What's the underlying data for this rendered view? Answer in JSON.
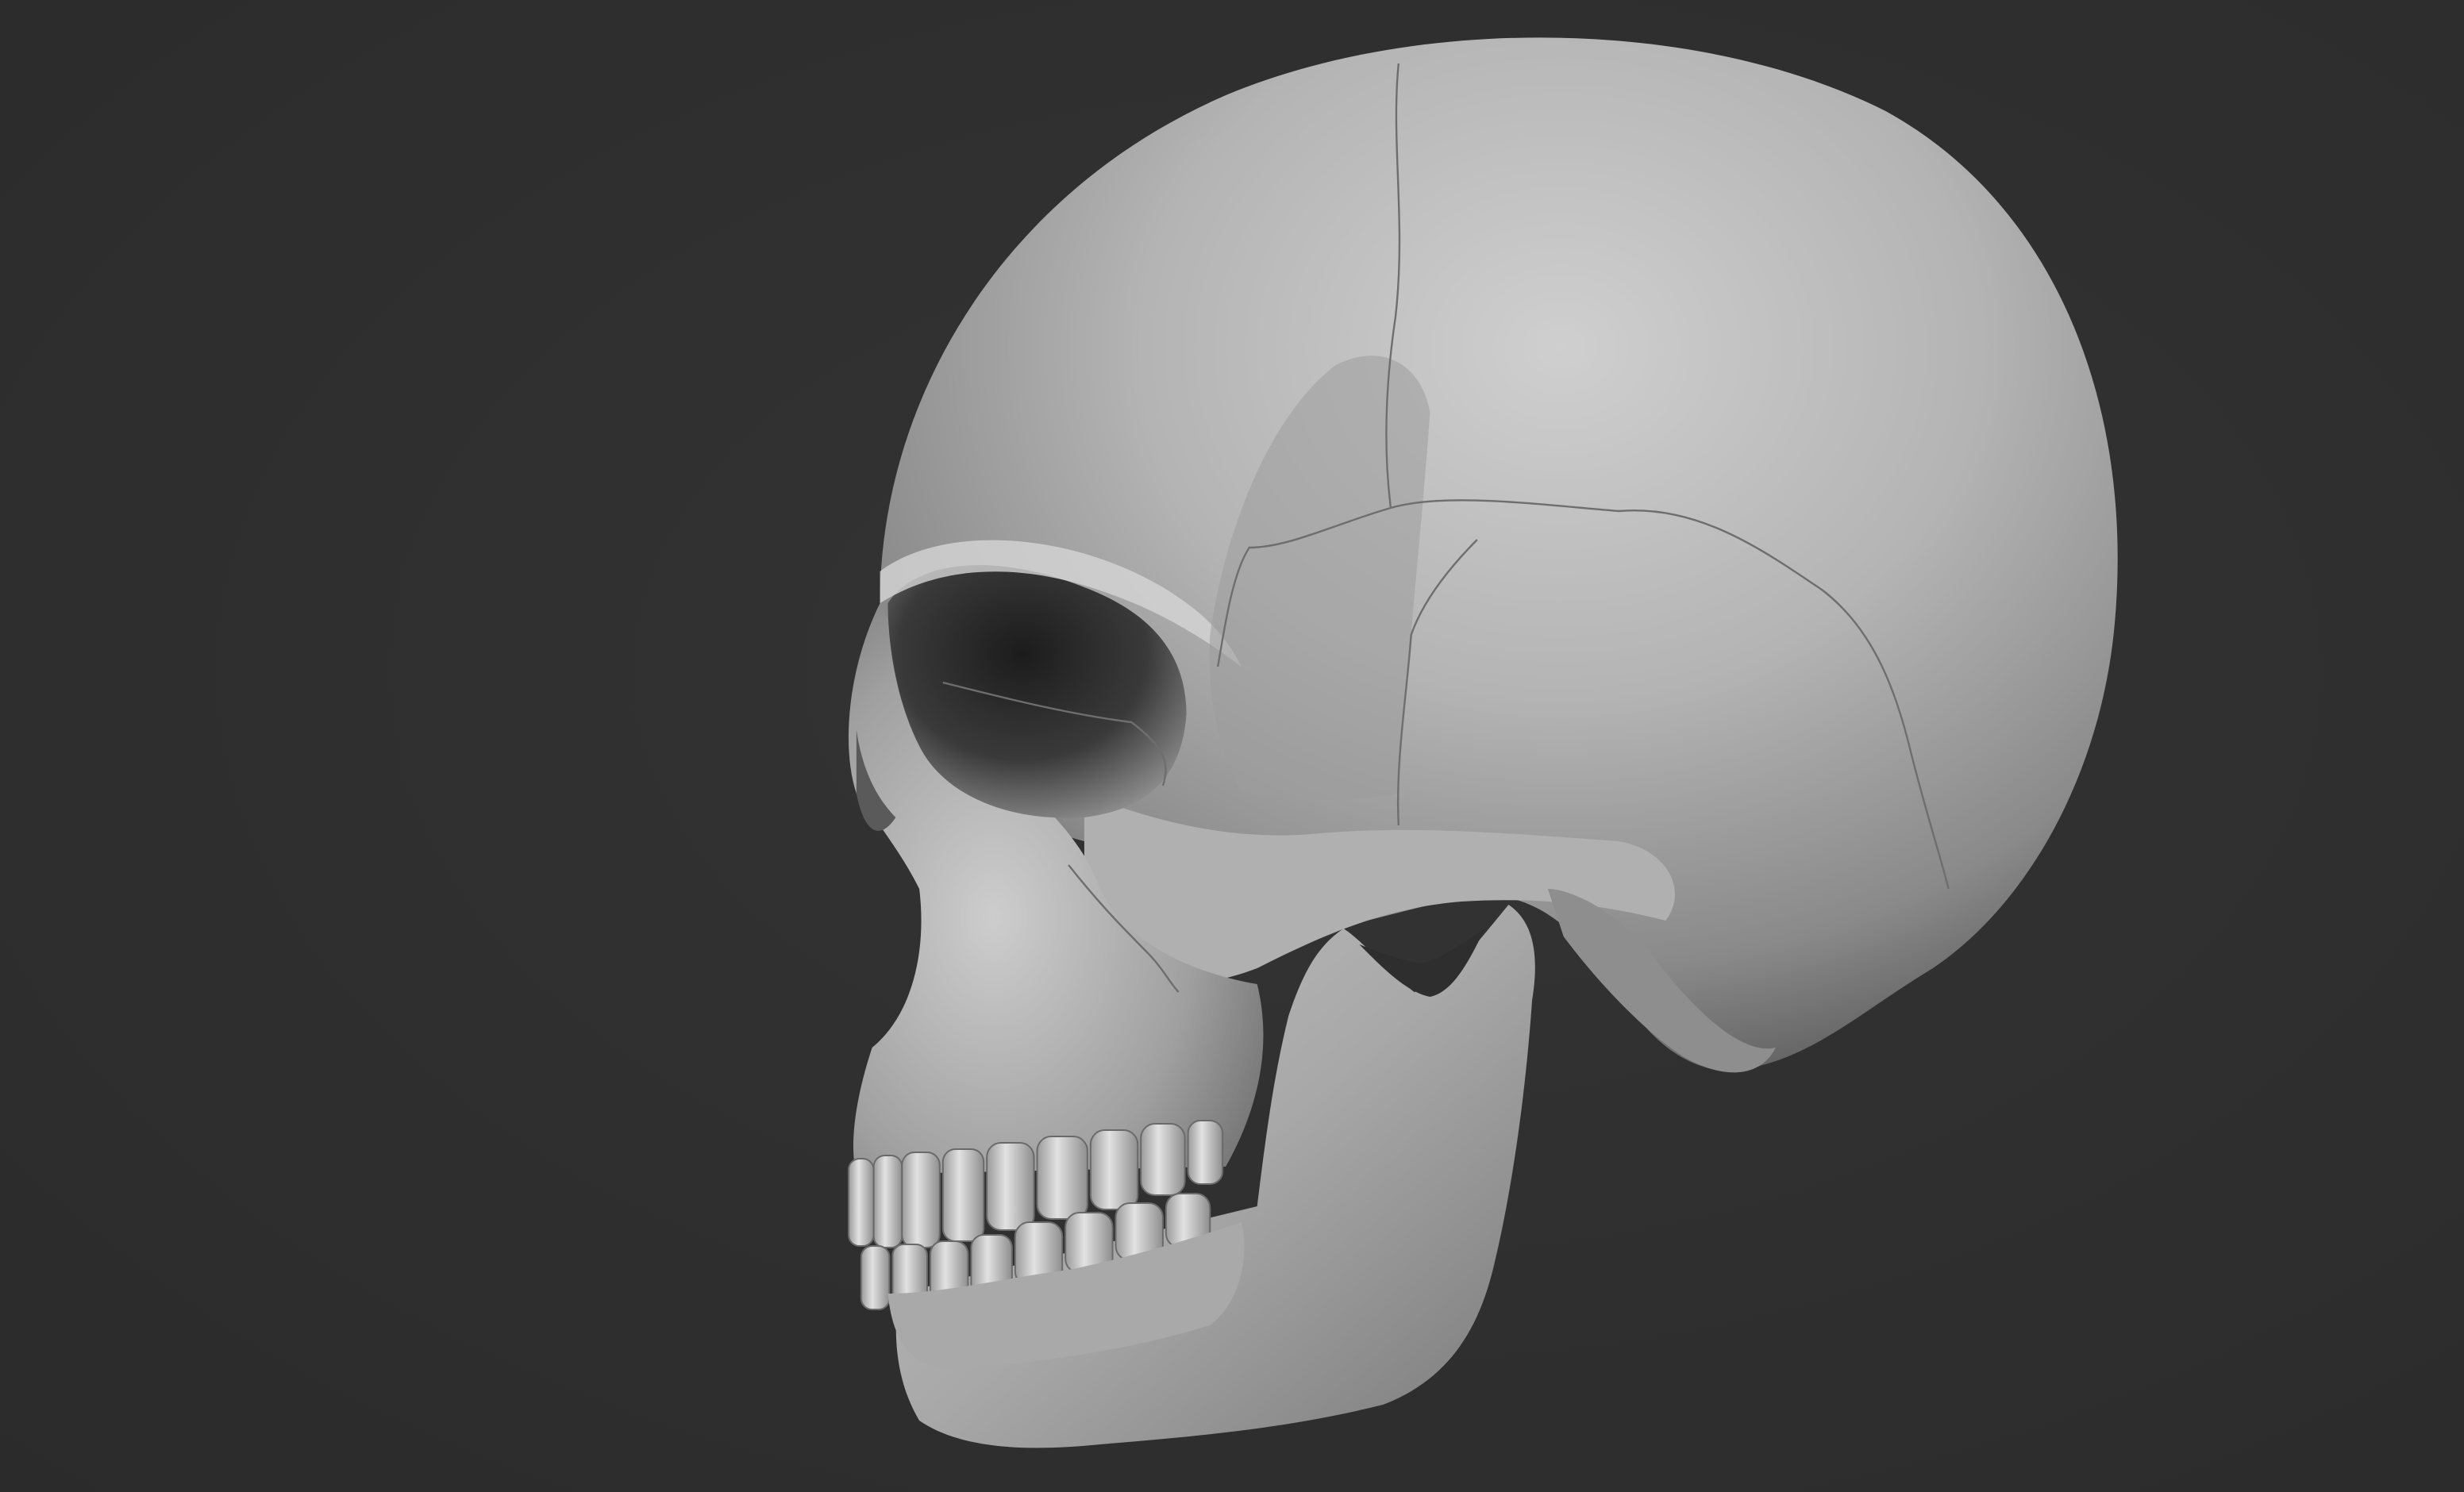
{
  "viewport": {
    "background_color": "#2f2f2f",
    "subject": "skull-model",
    "material": "matcap-grey"
  },
  "colors": {
    "bone_light": "#d8d8d8",
    "bone_mid": "#9c9c9c",
    "bone_shadow": "#3a3a3a",
    "suture_line": "#6e6e6e"
  }
}
